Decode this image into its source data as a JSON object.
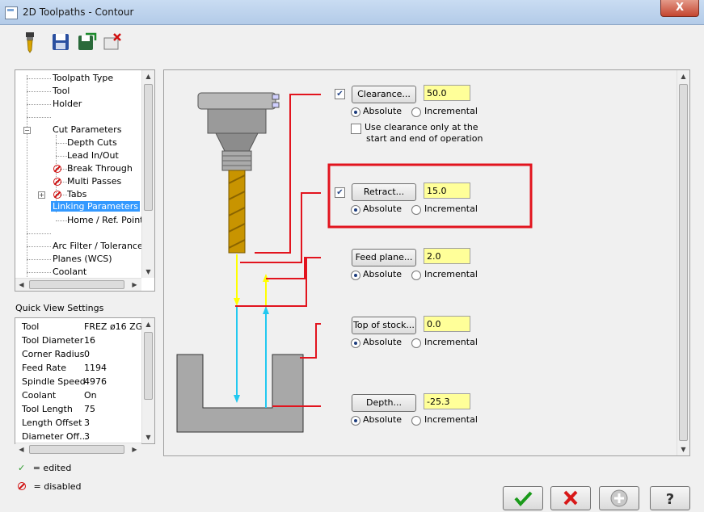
{
  "window": {
    "title": "2D Toolpaths - Contour",
    "close_label": "X"
  },
  "toolbar": {
    "items": [
      "tool-icon",
      "save-icon",
      "save-as-icon",
      "delete-icon"
    ]
  },
  "tree": {
    "items": [
      {
        "label": "Toolpath Type"
      },
      {
        "label": "Tool"
      },
      {
        "label": "Holder"
      },
      {
        "label": "Cut Parameters"
      },
      {
        "label": "Depth Cuts"
      },
      {
        "label": "Lead In/Out"
      },
      {
        "label": "Break Through"
      },
      {
        "label": "Multi Passes"
      },
      {
        "label": "Tabs"
      },
      {
        "label": "Linking Parameters"
      },
      {
        "label": "Home / Ref. Points"
      },
      {
        "label": "Arc Filter / Tolerance"
      },
      {
        "label": "Planes (WCS)"
      },
      {
        "label": "Coolant"
      }
    ]
  },
  "quick_view": {
    "title": "Quick View Settings",
    "rows": [
      {
        "label": "Tool",
        "value": "FREZ ø16 ZG..."
      },
      {
        "label": "Tool Diameter",
        "value": "16"
      },
      {
        "label": "Corner Radius",
        "value": "0"
      },
      {
        "label": "Feed Rate",
        "value": "1194"
      },
      {
        "label": "Spindle Speed",
        "value": "4976"
      },
      {
        "label": "Coolant",
        "value": "On"
      },
      {
        "label": "Tool Length",
        "value": "75"
      },
      {
        "label": "Length Offset",
        "value": "3"
      },
      {
        "label": "Diameter Off...",
        "value": "3"
      }
    ]
  },
  "legend": {
    "edited": "= edited",
    "disabled": "= disabled"
  },
  "params": {
    "clearance": {
      "button": "Clearance...",
      "value": "50.0",
      "checked": true
    },
    "clearance_option": "Use clearance only at the start and end of operation",
    "clearance_option_line1": "Use clearance only at the",
    "clearance_option_line2": "start and end of operation",
    "retract": {
      "button": "Retract...",
      "value": "15.0",
      "checked": true
    },
    "feed_plane": {
      "button": "Feed plane...",
      "value": "2.0"
    },
    "top_of_stock": {
      "button": "Top of stock...",
      "value": "0.0"
    },
    "depth": {
      "button": "Depth...",
      "value": "-25.3"
    },
    "absolute_label": "Absolute",
    "incremental_label": "Incremental"
  },
  "colors": {
    "highlight": "#e2141e",
    "yellow_field": "#ffff99",
    "retract_arrow": "#ffff00",
    "feed_arrow": "#22c8f0"
  },
  "bottom_buttons": [
    "ok-icon",
    "cancel-icon",
    "add-icon",
    "help-icon"
  ]
}
